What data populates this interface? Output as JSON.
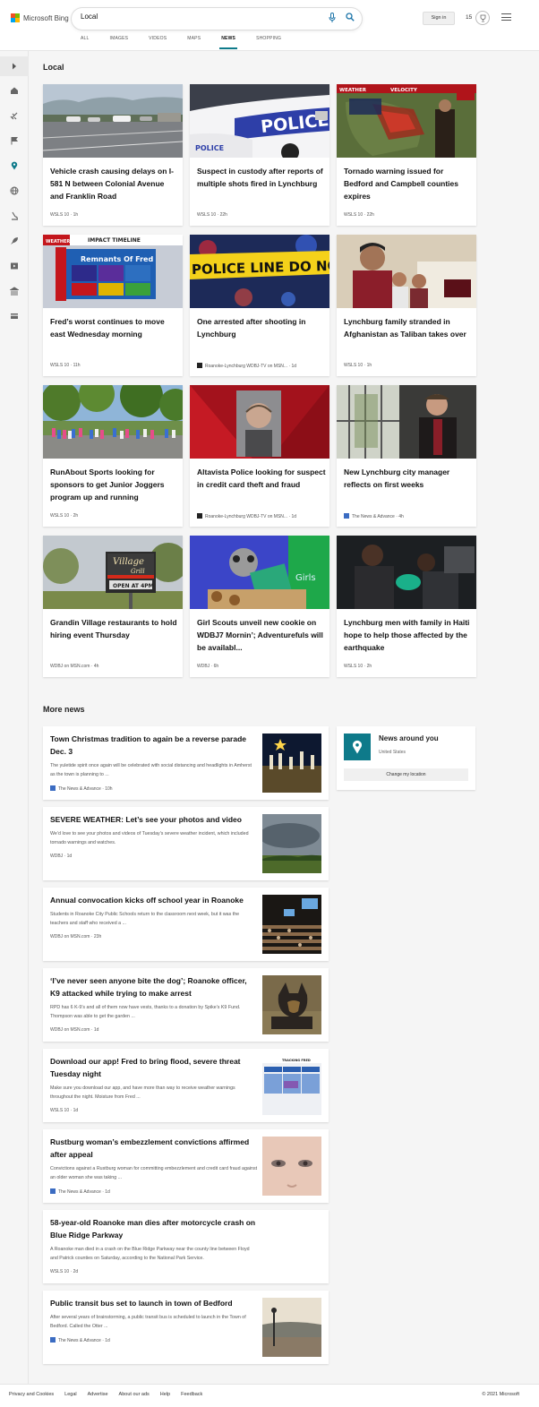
{
  "header": {
    "brand": "Microsoft Bing",
    "search_value": "Local",
    "signin_label": "Sign in",
    "rewards_count": "15",
    "tabs": [
      "ALL",
      "IMAGES",
      "VIDEOS",
      "MAPS",
      "NEWS",
      "SHOPPING"
    ],
    "active_tab": "NEWS"
  },
  "sidebar": {
    "icons": [
      "chevron-right-icon",
      "home-icon",
      "satellite-icon",
      "flag-icon",
      "location-pin-icon",
      "globe-icon",
      "microscope-icon",
      "rocket-icon",
      "play-icon",
      "bank-icon",
      "card-icon"
    ]
  },
  "local": {
    "heading": "Local",
    "cards": [
      {
        "title": "Vehicle crash causing delays on I-581 N between Colonial Avenue and Franklin Road",
        "source": "WSLS 10 · 1h"
      },
      {
        "title": "Suspect in custody after reports of multiple shots fired in Lynchburg",
        "source": "WSLS 10 · 22h"
      },
      {
        "title": "Tornado warning issued for Bedford and Campbell counties expires",
        "source": "WSLS 10 · 22h"
      },
      {
        "title": "Fred’s worst continues to move east Wednesday morning",
        "source": "WSLS 10 · 11h"
      },
      {
        "title": "One arrested after shooting in Lynchburg",
        "source": "Roanoke-Lynchburg WDBJ-TV on MSN... · 1d"
      },
      {
        "title": "Lynchburg family stranded in Afghanistan as Taliban takes over",
        "source": "WSLS 10 · 1h"
      },
      {
        "title": "RunAbout Sports looking for sponsors to get Junior Joggers program up and running",
        "source": "WSLS 10 · 2h"
      },
      {
        "title": "Altavista Police looking for suspect in credit card theft and fraud",
        "source": "Roanoke-Lynchburg WDBJ-TV on MSN... · 1d"
      },
      {
        "title": "New Lynchburg city manager reflects on first weeks",
        "source": "The News & Advance · 4h"
      },
      {
        "title": "Grandin Village restaurants to hold hiring event Thursday",
        "source": "WDBJ on MSN.com · 4h"
      },
      {
        "title": "Girl Scouts unveil new cookie on WDBJ7 Mornin’; Adventurefuls will be availabl...",
        "source": "WDBJ · 6h"
      },
      {
        "title": "Lynchburg men with family in Haiti hope to help those affected by the earthquake",
        "source": "WSLS 10 · 2h"
      }
    ],
    "image_text": {
      "police": "POLICE",
      "tape": "POLICE LINE DO NOT CROS",
      "fred_title": "Remnants Of Fred",
      "impact": "IMPACT TIMELINE",
      "weather": "WEATHER",
      "velocity": "VELOCITY",
      "village": "Village",
      "grill": "Grill",
      "open": "OPEN AT 4PM",
      "girls": "Girls"
    }
  },
  "more_news": {
    "heading": "More news",
    "items": [
      {
        "title": "Town Christmas tradition to again be a reverse parade Dec. 3",
        "snippet": "The yuletide spirit once again will be celebrated with social distancing and headlights in Amherst as the town is planning to ...",
        "source": "The News & Advance · 10h"
      },
      {
        "title": "SEVERE WEATHER: Let’s see your photos and video",
        "snippet": "We’d love to see your photos and videos of Tuesday’s severe weather incident, which included tornado warnings and watches.",
        "source": "WDBJ · 1d"
      },
      {
        "title": "Annual convocation kicks off school year in Roanoke",
        "snippet": "Students in Roanoke City Public Schools return to the classroom next week, but it was the teachers and staff who received a ...",
        "source": "WDBJ on MSN.com · 23h"
      },
      {
        "title": "‘I’ve never seen anyone bite the dog’; Roanoke officer, K9 attacked while trying to make arrest",
        "snippet": "RPD has 6 K-9’s and all of them now have vests, thanks to a donation by Spike’s K9 Fund. Thompson was able to get the garden ...",
        "source": "WDBJ on MSN.com · 1d"
      },
      {
        "title": "Download our app! Fred to bring flood, severe threat Tuesday night",
        "snippet": "Make sure you download our app, and have more than way to receive weather warnings throughout the night. Moisture from Fred ...",
        "source": "WSLS 10 · 1d"
      },
      {
        "title": "Rustburg woman’s embezzlement convictions affirmed after appeal",
        "snippet": "Convictions against a Rustburg woman for committing embezzlement and credit card fraud against an older woman she was taking ...",
        "source": "The News & Advance · 1d"
      },
      {
        "title": "58-year-old Roanoke man dies after motorcycle crash on Blue Ridge Parkway",
        "snippet": "A Roanoke man died in a crash on the Blue Ridge Parkway near the county line between Floyd and Patrick counties on Saturday, according to the National Park Service.",
        "source": "WSLS 10 · 2d"
      },
      {
        "title": "Public transit bus set to launch in town of Bedford",
        "snippet": "After several years of brainstorming, a public transit bus is scheduled to launch in the Town of Bedford. Called the Otter ...",
        "source": "The News & Advance · 1d"
      }
    ],
    "thumb_text": {
      "tracking": "TRACKING FRED"
    }
  },
  "around": {
    "title": "News around you",
    "location": "United States",
    "button": "Change my location"
  },
  "footer": {
    "links": [
      "Privacy and Cookies",
      "Legal",
      "Advertise",
      "About our ads",
      "Help",
      "Feedback"
    ],
    "copyright": "© 2021 Microsoft"
  },
  "colors": {
    "accent": "#0e7a8a",
    "bing_blue": "#1a73a8"
  }
}
